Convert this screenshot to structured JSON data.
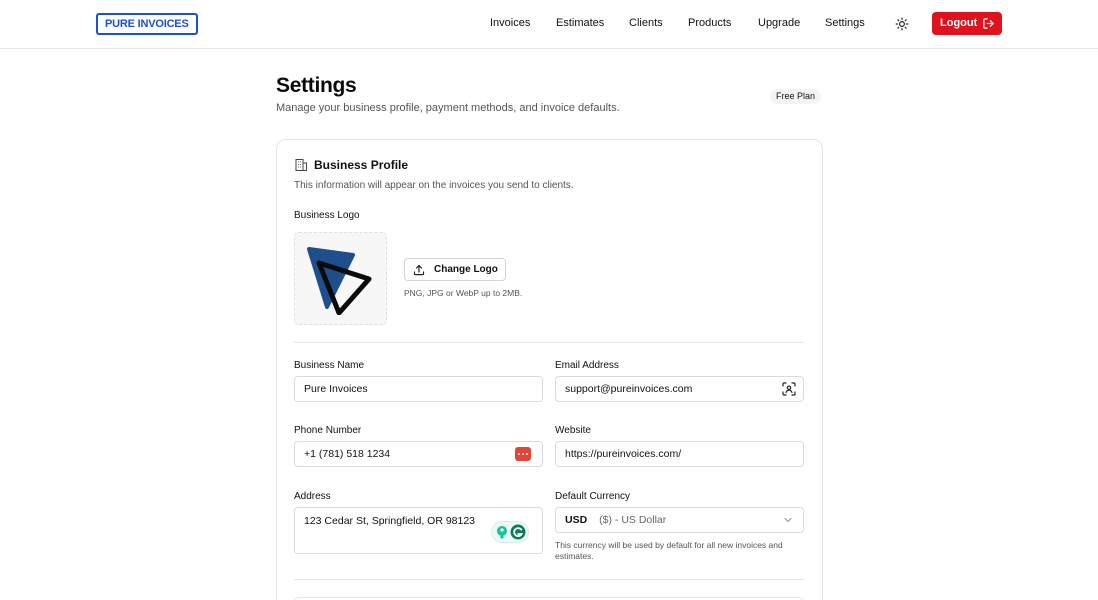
{
  "brand": "PURE INVOICES",
  "nav": {
    "items": [
      "Invoices",
      "Estimates",
      "Clients",
      "Products",
      "Upgrade",
      "Settings"
    ],
    "logout_label": "Logout"
  },
  "header": {
    "title": "Settings",
    "subtitle": "Manage your business profile, payment methods, and invoice defaults.",
    "plan_badge": "Free Plan"
  },
  "profile": {
    "title": "Business Profile",
    "description": "This information will appear on the invoices you send to clients.",
    "logo_label": "Business Logo",
    "change_logo_label": "Change Logo",
    "logo_hint": "PNG, JPG or WebP up to 2MB.",
    "fields": {
      "business_name": {
        "label": "Business Name",
        "value": "Pure Invoices"
      },
      "email": {
        "label": "Email Address",
        "value": "support@pureinvoices.com"
      },
      "phone": {
        "label": "Phone Number",
        "value": "+1 (781) 518 1234"
      },
      "website": {
        "label": "Website",
        "value": "https://pureinvoices.com/"
      },
      "address": {
        "label": "Address",
        "value": "123 Cedar St, Springfield, OR 98123"
      },
      "currency": {
        "label": "Default Currency",
        "code": "USD",
        "name": "($) - US Dollar",
        "help": "This currency will be used by default for all new invoices and estimates."
      }
    }
  },
  "colors": {
    "brand_blue": "#1d4ed8",
    "logout_red": "#e0121e",
    "logo_navy": "#1f4e8c"
  },
  "icons": {
    "theme": "sun-icon",
    "logout": "logout-icon",
    "card_head": "building-icon",
    "upload": "upload-icon",
    "email_field": "face-scan-icon",
    "phone_field": "password-manager-icon",
    "address_field": "grammarly-icon",
    "currency": "chevron-down-icon"
  }
}
